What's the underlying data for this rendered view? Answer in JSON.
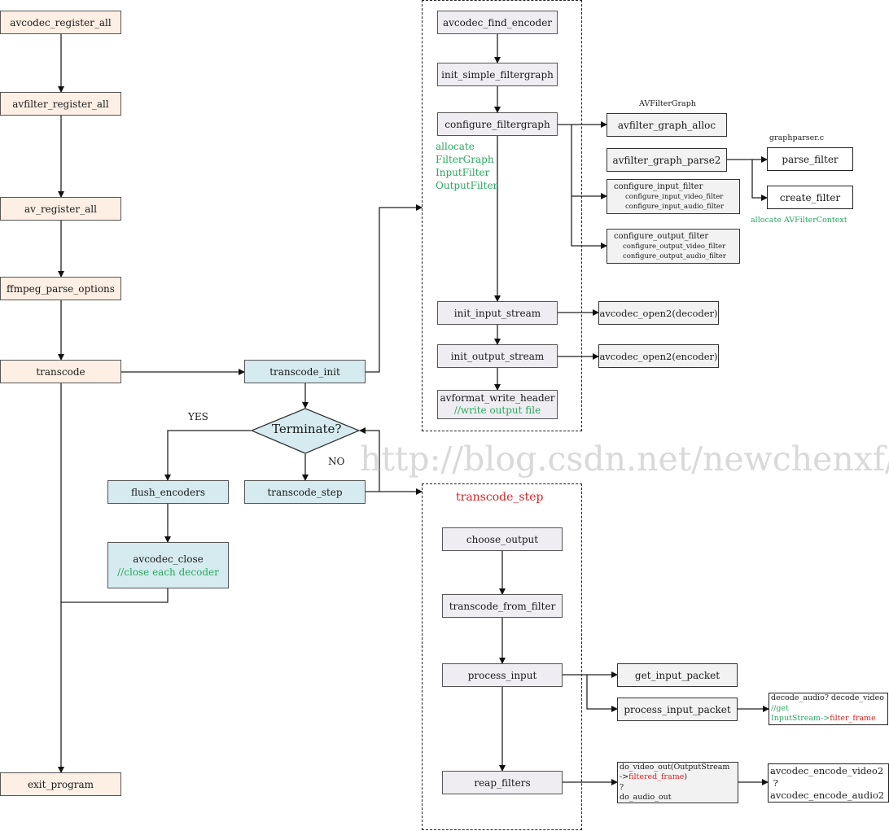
{
  "diagram": {
    "main_flow": {
      "avcodec_register_all": "avcodec_register_all",
      "avfilter_register_all": "avfilter_register_all",
      "av_register_all": "av_register_all",
      "ffmpeg_parse_options": "ffmpeg_parse_options",
      "transcode": "transcode",
      "exit_program": "exit_program"
    },
    "transcode_flow": {
      "transcode_init": "transcode_init",
      "terminate": "Terminate?",
      "yes_label": "YES",
      "no_label": "NO",
      "transcode_step": "transcode_step",
      "flush_encoders": "flush_encoders",
      "avcodec_close": "avcodec_close",
      "avcodec_close_comment": "//close each decoder"
    },
    "init_group": {
      "avcodec_find_encoder": "avcodec_find_encoder",
      "init_simple_filtergraph": "init_simple_filtergraph",
      "configure_filtergraph": "configure_filtergraph",
      "allocate_note": [
        "allocate",
        "FilterGraph",
        "InputFilter",
        "OutputFilter"
      ],
      "init_input_stream": "init_input_stream",
      "init_output_stream": "init_output_stream",
      "avformat_write_header": "avformat_write_header",
      "avformat_write_header_comment": "//write output file"
    },
    "filtergraph_detail": {
      "avfiltergraph_caption": "AVFilterGraph",
      "avfilter_graph_alloc": "avfilter_graph_alloc",
      "avfilter_graph_parse2": "avfilter_graph_parse2",
      "graphparser_caption": "graphparser.c",
      "parse_filter": "parse_filter",
      "create_filter": "create_filter",
      "allocate_avfiltercontext": "allocate AVFilterContext",
      "configure_input_filter": "configure_input_filter",
      "configure_input_video_filter": "configure_input_video_filter",
      "configure_input_audio_filter": "configure_input_audio_filter",
      "configure_output_filter": "configure_output_filter",
      "configure_output_video_filter": "configure_output_video_filter",
      "configure_output_audio_filter": "configure_output_audio_filter"
    },
    "open_codecs": {
      "decoder": "avcodec_open2(decoder)",
      "encoder": "avcodec_open2(encoder)"
    },
    "step_group": {
      "title": "transcode_step",
      "choose_output": "choose_output",
      "transcode_from_filter": "transcode_from_filter",
      "process_input": "process_input",
      "reap_filters": "reap_filters",
      "get_input_packet": "get_input_packet",
      "process_input_packet": "process_input_packet",
      "decode_line1": "decode_audio? decode_video",
      "decode_line2": "//get",
      "decode_line3_a": "InputStream->",
      "decode_line3_b": "filter_frame",
      "do_out_line1": "do_video_out(OutputStream",
      "do_out_line2_a": "->",
      "do_out_line2_b": "filtered_frame",
      "do_out_line2_c": ")",
      "do_out_line3": "?",
      "do_out_line4": "do_audio_out",
      "encode_line1": "avcodec_encode_video2",
      "encode_line2": " ?",
      "encode_line3": "avcodec_encode_audio2"
    },
    "watermark": "http://blog.csdn.net/newchenxf/",
    "colors": {
      "main_fill": "#fdefe4",
      "transcode_fill": "#d5ebef",
      "group_fill": "#efedf2",
      "detail_fill": "#f2f2f2",
      "comment_green": "#2aa860",
      "highlight_red": "#e02020"
    }
  }
}
